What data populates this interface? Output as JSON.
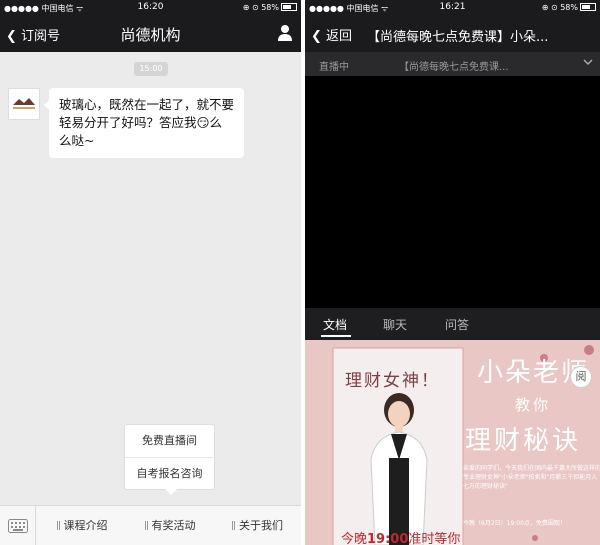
{
  "left": {
    "status": {
      "carrier": "●●●●● 中国电信 ᯤ",
      "time": "16:20",
      "battery": "⊕ ⊙ 58%"
    },
    "nav": {
      "back_label": "订阅号",
      "title": "尚德机构"
    },
    "chat": {
      "timestamp": "15:00",
      "message": "玻璃心，既然在一起了，就不要轻易分开了好吗？答应我😏么么哒~"
    },
    "popup_menu": {
      "items": [
        "免费直播间",
        "自考报名咨询"
      ]
    },
    "menu_bar": {
      "items": [
        "课程介绍",
        "有奖活动",
        "关于我们"
      ]
    }
  },
  "right": {
    "status": {
      "carrier": "●●●●● 中国电信 ᯤ",
      "time": "16:21",
      "battery": "⊕ ⊙ 58%"
    },
    "nav": {
      "back_label": "返回",
      "title": "【尚德每晚七点免费课】小朵..."
    },
    "live_bar": {
      "status_label": "直播中",
      "course_title": "【尚德每晚七点免费课..."
    },
    "tabs": [
      "文档",
      "聊天",
      "问答"
    ],
    "document": {
      "title_a": "理财女神！",
      "title_b": "小朵老师",
      "title_c": "教你",
      "title_d": "理财秘诀",
      "body": "亲爱的同学们，今天我们在国内最千篇大所做这样的专业理财女神\"小朵老师\"拍卖和\"月薪三千但能月入七万的理财秘诀\"",
      "date": "今晚（6月2日）19:00点，免费围观！",
      "time_prefix": "今晚",
      "time_bold": "19:00",
      "time_suffix": "准时等你",
      "expand_label": "阅"
    }
  },
  "colors": {
    "bar_dark": "#1b1b1d",
    "chat_bg": "#ebebeb",
    "poster_pink": "#e8c7c4",
    "time_red": "#c0282f"
  }
}
